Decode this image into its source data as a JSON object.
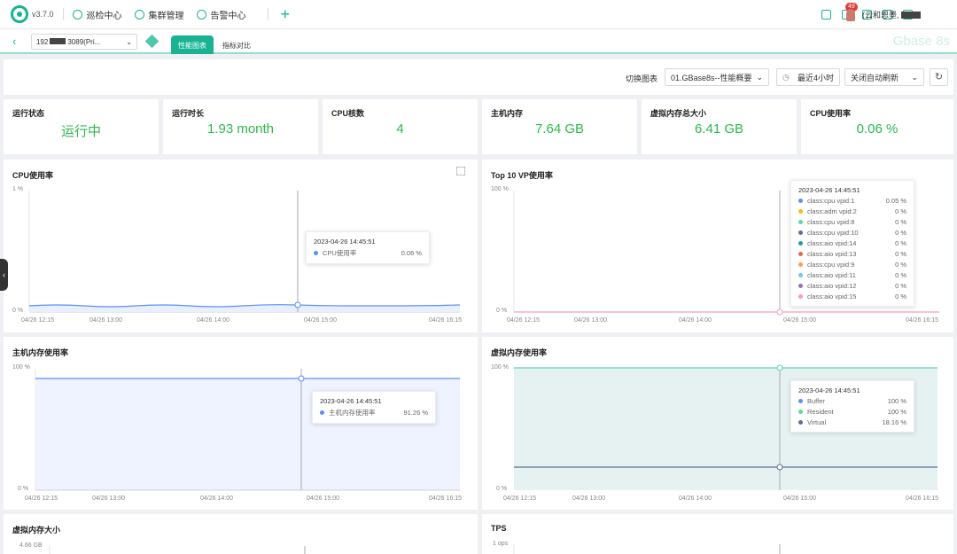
{
  "app": {
    "version": "v3.7.0",
    "logo": "logo-ring-icon"
  },
  "nav": [
    {
      "label": "巡检中心",
      "icon": "inspect-icon"
    },
    {
      "label": "集群管理",
      "icon": "cluster-icon"
    },
    {
      "label": "告警中心",
      "icon": "alarm-icon"
    }
  ],
  "notifications": {
    "count": "49"
  },
  "user": {
    "name": "(云和恩墨,"
  },
  "subbar": {
    "instance_prefix": "192",
    "instance_suffix": "3089(Pri...",
    "tabs": [
      "性能图表",
      "指标对比"
    ],
    "watermark": "Gbase 8s"
  },
  "toolbar": {
    "switch_label": "切换图表",
    "chart_select": "01.GBase8s--性能概要",
    "time_range": "最近4小时",
    "refresh_mode": "关闭自动刷新"
  },
  "cards": [
    {
      "label": "运行状态",
      "value": "运行中"
    },
    {
      "label": "运行时长",
      "value": "1.93 month"
    },
    {
      "label": "CPU核数",
      "value": "4"
    },
    {
      "label": "主机内存",
      "value": "7.64 GB"
    },
    {
      "label": "虚拟内存总大小",
      "value": "6.41 GB"
    },
    {
      "label": "CPU使用率",
      "value": "0.06 %"
    }
  ],
  "panels": {
    "cpu": {
      "title": "CPU使用率",
      "ymax": "1 %",
      "ymin": "0 %",
      "x_ticks": [
        "04/26 12:15",
        "04/26 13:00",
        "04/26 14:00",
        "04/26 15:00",
        "04/26 16:15"
      ],
      "tooltip": {
        "time": "2023-04-26 14:45:51",
        "rows": [
          {
            "name": "CPU使用率",
            "value": "0.06 %",
            "color": "#5b8ff9"
          }
        ]
      }
    },
    "top10": {
      "title": "Top 10 VP使用率",
      "ymax": "100 %",
      "ymin": "0 %",
      "x_ticks": [
        "04/26 12:15",
        "04/26 13:00",
        "04/26 14:00",
        "04/26 15:00",
        "04/26 16:15"
      ],
      "tooltip": {
        "time": "2023-04-26 14:45:51",
        "rows": [
          {
            "name": "class:cpu vpid:1",
            "value": "0.05 %",
            "color": "#5b8ff9"
          },
          {
            "name": "class:adm vpid:2",
            "value": "0 %",
            "color": "#f6bd16"
          },
          {
            "name": "class:cpu vpid:8",
            "value": "0 %",
            "color": "#5ad8a6"
          },
          {
            "name": "class:cpu vpid:10",
            "value": "0 %",
            "color": "#5d7092"
          },
          {
            "name": "class:aio vpid:14",
            "value": "0 %",
            "color": "#269a99"
          },
          {
            "name": "class:aio vpid:13",
            "value": "0 %",
            "color": "#e8684a"
          },
          {
            "name": "class:cpu vpid:9",
            "value": "0 %",
            "color": "#ff9d4d"
          },
          {
            "name": "class:aio vpid:11",
            "value": "0 %",
            "color": "#6dc8ec"
          },
          {
            "name": "class:aio vpid:12",
            "value": "0 %",
            "color": "#9270ca"
          },
          {
            "name": "class:aio vpid:15",
            "value": "0 %",
            "color": "#ff99c3"
          }
        ]
      }
    },
    "hostmem": {
      "title": "主机内存使用率",
      "ymax": "100 %",
      "ymin": "0 %",
      "x_ticks": [
        "04/26 12:15",
        "04/26 13:00",
        "04/26 14:00",
        "04/26 15:00",
        "04/26 16:15"
      ],
      "tooltip": {
        "time": "2023-04-26 14:45:51",
        "rows": [
          {
            "name": "主机内存使用率",
            "value": "91.26 %",
            "color": "#5b8ff9"
          }
        ]
      }
    },
    "vmem": {
      "title": "虚拟内存使用率",
      "ymax": "100 %",
      "ymin": "0 %",
      "x_ticks": [
        "04/26 12:15",
        "04/26 13:00",
        "04/26 14:00",
        "04/26 15:00",
        "04/26 16:15"
      ],
      "tooltip": {
        "time": "2023-04-26 14:45:51",
        "rows": [
          {
            "name": "Buffer",
            "value": "100 %",
            "color": "#5b8ff9"
          },
          {
            "name": "Resident",
            "value": "100 %",
            "color": "#5ad8a6"
          },
          {
            "name": "Virtual",
            "value": "18.16 %",
            "color": "#5d7092"
          }
        ]
      }
    },
    "vmemsize": {
      "title": "虚拟内存大小",
      "ymax": "4.66 GB"
    },
    "tps": {
      "title": "TPS",
      "ymax": "1 ops"
    }
  }
}
